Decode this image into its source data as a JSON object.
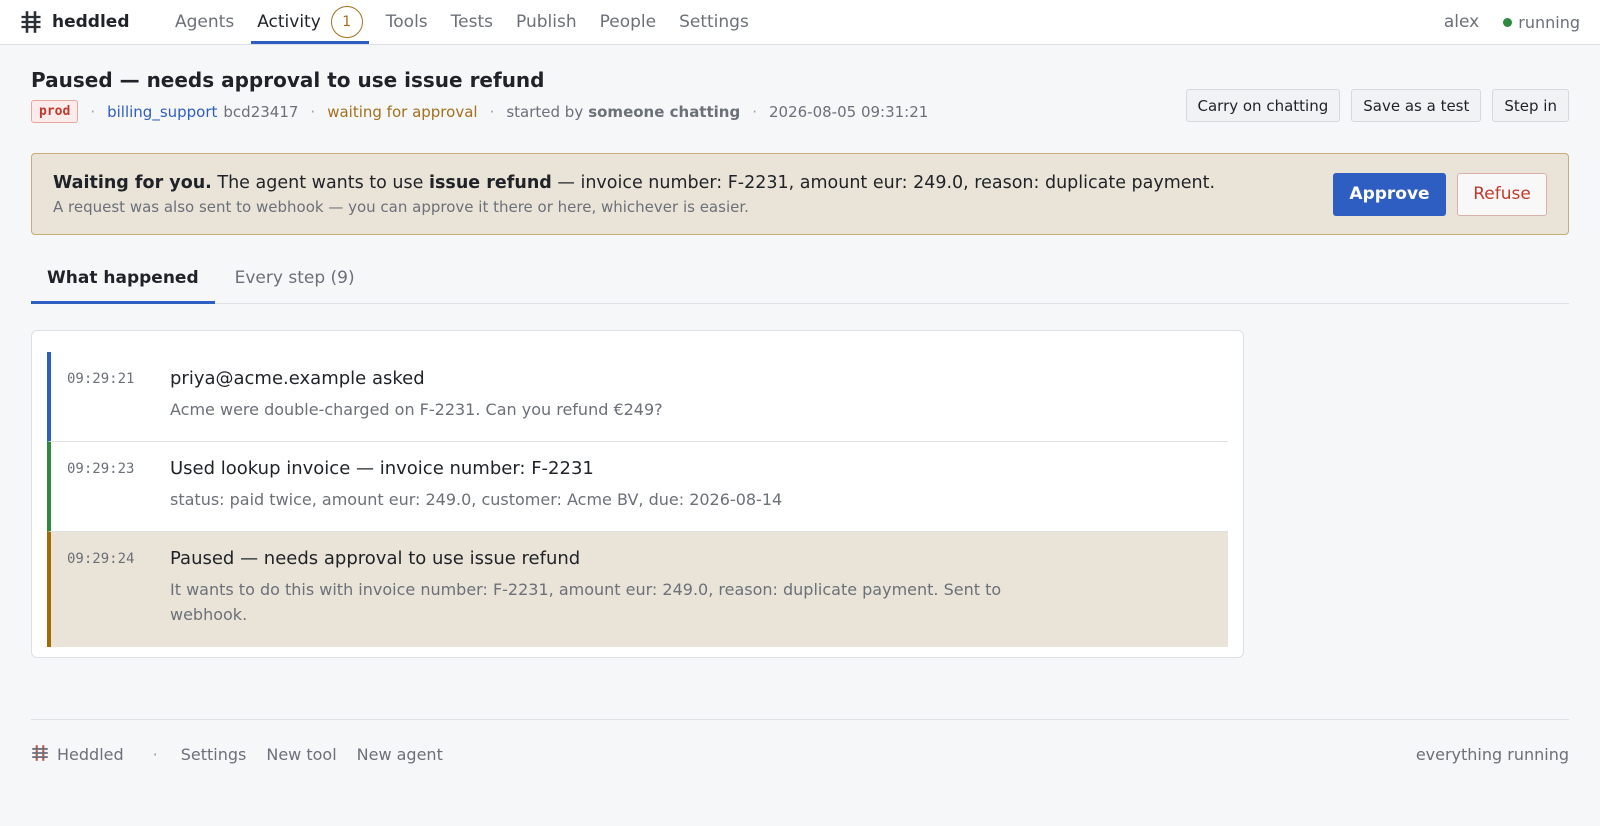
{
  "nav": {
    "brand": "heddled",
    "links": [
      "Agents",
      "Activity",
      "Tools",
      "Tests",
      "Publish",
      "People",
      "Settings"
    ],
    "activity_badge": "1",
    "user": "alex",
    "status": "running",
    "status_color": "#2d8a3e"
  },
  "header": {
    "title": "Paused — needs approval to use issue refund",
    "env": "prod",
    "agent": "billing_support",
    "agent_id": "bcd23417",
    "state": "waiting for approval",
    "started_by_label": "started by",
    "started_by": "someone chatting",
    "timestamp": "2026-08-05 09:31:21",
    "actions": [
      "Carry on chatting",
      "Save as a test",
      "Step in"
    ]
  },
  "approval": {
    "lead": "Waiting for you.",
    "text_before": "The agent wants to use",
    "tool": "issue refund",
    "text_after": "— invoice number: F-2231, amount eur: 249.0, reason: duplicate payment.",
    "sub": "A request was also sent to webhook — you can approve it there or here, whichever is easier.",
    "approve_label": "Approve",
    "refuse_label": "Refuse"
  },
  "tabs": [
    {
      "label": "What happened",
      "active": true
    },
    {
      "label": "Every step (9)",
      "active": false
    }
  ],
  "events": [
    {
      "time": "09:29:21",
      "title": "priya@acme.example asked",
      "detail": "Acme were double-charged on F-2231. Can you refund €249?"
    },
    {
      "time": "09:29:23",
      "title": "Used lookup invoice — invoice number: F-2231",
      "detail": "status: paid twice, amount eur: 249.0, customer: Acme BV, due: 2026-08-14"
    },
    {
      "time": "09:29:24",
      "title": "Paused — needs approval to use issue refund",
      "detail": "It wants to do this with invoice number: F-2231, amount eur: 249.0, reason: duplicate payment. Sent to webhook."
    }
  ],
  "footer": {
    "brand": "Heddled",
    "links": [
      "Settings",
      "New tool",
      "New agent"
    ],
    "status": "everything running"
  },
  "colors": {
    "accent": "#2f5ec2",
    "warning": "#a4701f",
    "danger": "#c0392b",
    "success": "#2d8a3e",
    "banner_bg": "#eae4d8"
  },
  "icons": {
    "brand": "heddle-grid-icon",
    "status": "status-dot-icon"
  }
}
